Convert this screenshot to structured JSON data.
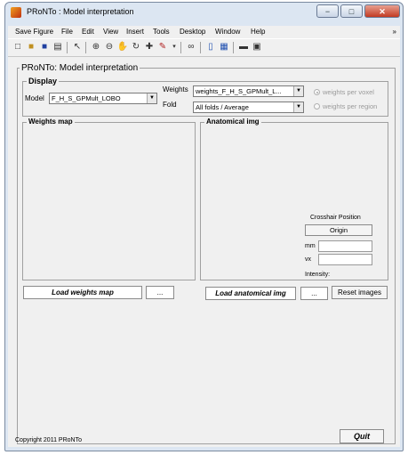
{
  "window": {
    "title": "PRoNTo : Model interpretation",
    "minimize": "−",
    "maximize": "□",
    "close": "✕"
  },
  "menu": {
    "items": [
      "Save Figure",
      "File",
      "Edit",
      "View",
      "Insert",
      "Tools",
      "Desktop",
      "Window",
      "Help"
    ],
    "overflow": "»"
  },
  "toolbar": {
    "icons": [
      "new-file-icon",
      "open-folder-icon",
      "save-icon",
      "print-icon",
      "pointer-icon",
      "zoom-in-icon",
      "zoom-out-icon",
      "pan-icon",
      "rotate-icon",
      "data-cursor-icon",
      "brush-icon",
      "link-icon",
      "colorbar-icon",
      "legend-icon",
      "hide-tools-icon",
      "dock-icon"
    ]
  },
  "panel": {
    "title": "PRoNTo: Model interpretation",
    "display_title": "Display",
    "model_label": "Model",
    "model_value": "F_H_S_GPMult_LOBO",
    "weights_label": "Weights",
    "weights_value": "weights_F_H_S_GPMult_L...",
    "fold_label": "Fold",
    "fold_value": "All folds / Average",
    "radio_voxel": "weights per voxel",
    "radio_region": "weights per region",
    "weights_map_title": "Weights map",
    "anat_title": "Anatomical img",
    "crosshair_label": "Crosshair Position",
    "origin_button": "Origin",
    "mm_label": "mm",
    "vx_label": "vx",
    "intensity_label": "Intensity:",
    "load_weights_button": "Load weights map",
    "browse_weights_button": "...",
    "load_anat_button": "Load anatomical img",
    "browse_anat_button": "...",
    "reset_button": "Reset images",
    "copyright": "Copyright 2011 PRoNTo",
    "quit_button": "Quit"
  }
}
